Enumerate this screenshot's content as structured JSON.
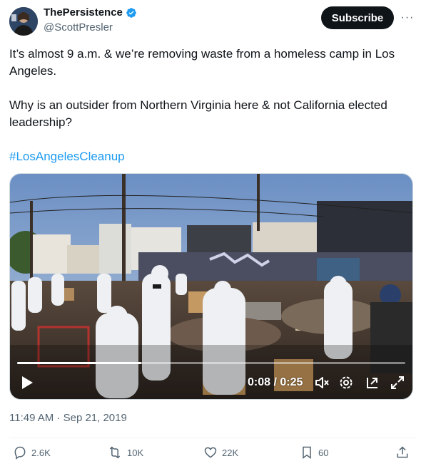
{
  "author": {
    "display_name": "ThePersistence",
    "handle": "@ScottPresler",
    "verified": true,
    "avatar_icon": "avatar-icon"
  },
  "header": {
    "subscribe_label": "Subscribe",
    "more_label": "···"
  },
  "tweet": {
    "paragraph_1": "It’s almost 9 a.m. & we’re removing waste from a homeless camp in Los Angeles.",
    "paragraph_2": "Why is an outsider from Northern Virginia here & not California elected leadership?",
    "hashtag": "#LosAngelesCleanup",
    "timestamp": "11:49 AM · Sep 21, 2019"
  },
  "video": {
    "time_display": "0:08 / 0:25",
    "progress_fraction": 0.32,
    "controls": [
      "play-icon",
      "mute-icon",
      "settings-icon",
      "pip-icon",
      "fullscreen-icon"
    ]
  },
  "actions": {
    "replies": "2.6K",
    "reposts": "10K",
    "likes": "22K",
    "bookmarks": "60"
  },
  "colors": {
    "accent": "#1d9bf0",
    "text": "#0f1419",
    "secondary": "#536471",
    "button_bg": "#0f1419"
  }
}
